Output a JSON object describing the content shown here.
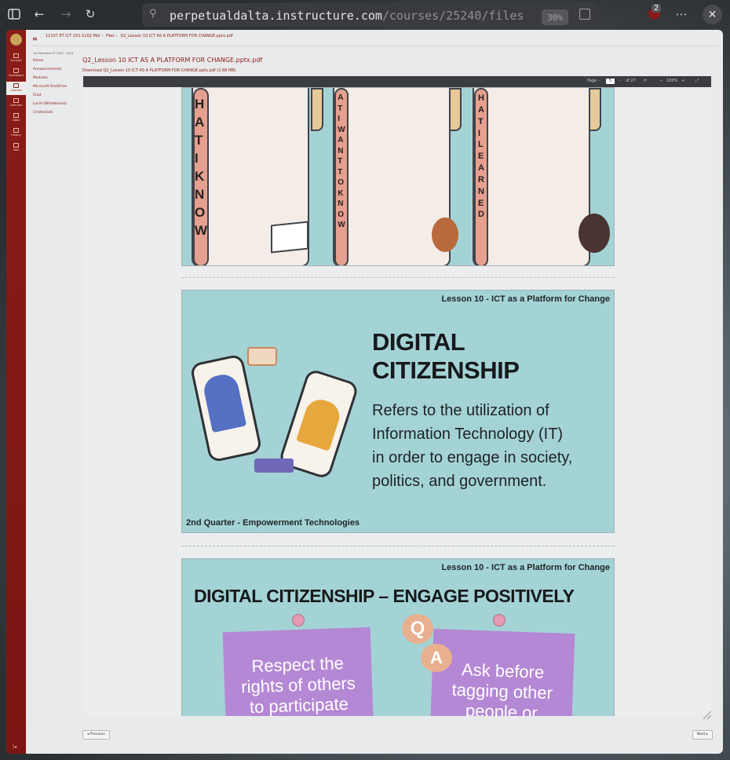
{
  "browser": {
    "url_host": "perpetualdalta.instructure.com",
    "url_path": "/courses/25240/files",
    "zoom": "30%",
    "extension_badge": "2",
    "icons": [
      "sidebar-toggle-icon",
      "back-icon",
      "forward-icon",
      "reload-icon",
      "site-info-icon",
      "reader-icon",
      "ublock-icon",
      "more-icon",
      "close-icon"
    ]
  },
  "lms": {
    "breadcrumbs": [
      "11107 ET ICT 251-1102 Mol",
      "Files",
      "Q2_Lesson 10 ICT AS A PLATFORM FOR CHANGE.pptx.pdf"
    ],
    "global_nav": [
      "Account",
      "Dashboard",
      "Courses",
      "Calendar",
      "Inbox",
      "History",
      "Help"
    ],
    "term": "1st Semester SY 2023 - 2024",
    "course_nav": [
      "Home",
      "Announcements",
      "Modules",
      "Microsoft OneDrive",
      "Chat",
      "Lucid (Whiteboard)",
      "Credentials"
    ],
    "file_title": "Q2_Lesson 10 ICT AS A PLATFORM FOR CHANGE.pptx.pdf",
    "download_text": "Download Q2_Lesson 10 ICT AS A PLATFORM FOR CHANGE.pptx.pdf (2.68 MB)",
    "previous_label": "◂ Previous",
    "next_label": "Next ▸"
  },
  "pdf_toolbar": {
    "page_label": "Page",
    "page_number": "5",
    "page_total": "of 27",
    "zoom": "100%"
  },
  "slides": {
    "s1_columns": [
      "WHAT I KNOW",
      "WHAT I WANT TO KNOW",
      "WHAT I LEARNED"
    ],
    "s1_col1": "HAT I KNOW",
    "s1_col2": "AT I WANT TO KNOW",
    "s1_col3": "HAT I LEARNED",
    "s2_header": "Lesson 10 - ICT as a Platform for Change",
    "s2_title_1": "DIGITAL",
    "s2_title_2": "CITIZENSHIP",
    "s2_body_1": "Refers to the utilization of",
    "s2_body_2": "Information Technology (IT)",
    "s2_body_3": "in order to engage in society,",
    "s2_body_4": "politics, and government.",
    "s2_footer": "2nd Quarter - Empowerment Technologies",
    "s3_header": "Lesson 10 - ICT as a Platform for Change",
    "s3_title": "DIGITAL CITIZENSHIP – ENGAGE POSITIVELY",
    "s3_note1_l1": "Respect the",
    "s3_note1_l2": "rights of others",
    "s3_note1_l3": "to participate",
    "s3_note2_l1": "Ask before",
    "s3_note2_l2": "tagging other",
    "s3_note2_l3": "people or",
    "s3_q": "Q",
    "s3_a": "A"
  }
}
